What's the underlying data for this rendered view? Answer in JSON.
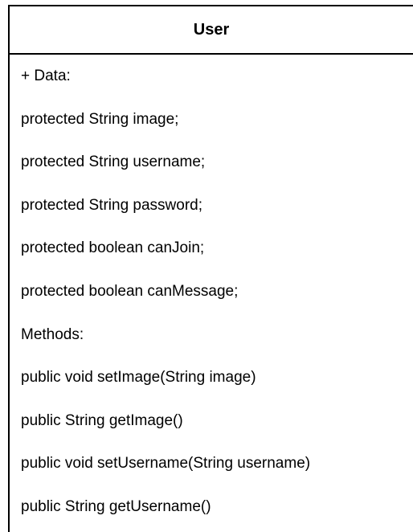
{
  "class": {
    "name": "User",
    "lines": [
      "+ Data:",
      "protected String image;",
      "protected String username;",
      "protected String password;",
      "protected boolean canJoin;",
      "protected boolean canMessage;",
      "Methods:",
      "public void setImage(String image)",
      "public String getImage()",
      "public void setUsername(String username)",
      "public String getUsername()"
    ]
  }
}
